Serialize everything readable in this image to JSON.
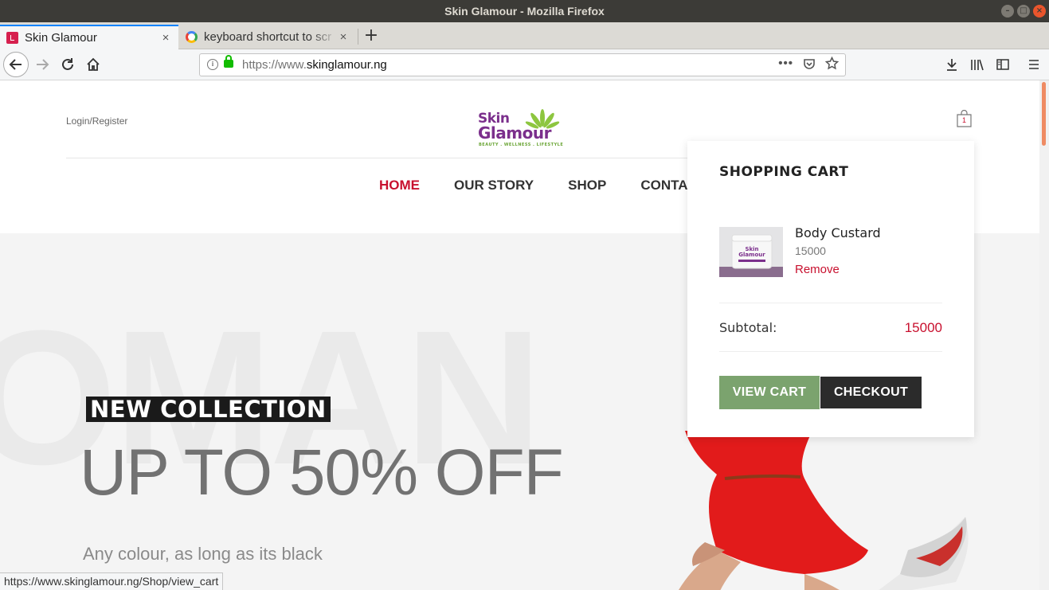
{
  "window": {
    "title": "Skin Glamour - Mozilla Firefox"
  },
  "tabs": [
    {
      "label": "Skin Glamour",
      "active": true
    },
    {
      "label": "keyboard shortcut to scr",
      "active": false
    }
  ],
  "url": {
    "scheme": "https://www.",
    "host": "skinglamour.ng"
  },
  "site": {
    "login_label": "Login/Register",
    "logo": {
      "line1": "Skin",
      "line2": "Glamour",
      "tagline": "BEAUTY . WELLNESS . LIFESTYLE"
    },
    "cart_count": "1",
    "nav": [
      {
        "label": "HOME",
        "active": true
      },
      {
        "label": "OUR STORY",
        "active": false
      },
      {
        "label": "SHOP",
        "active": false
      },
      {
        "label": "CONTACT",
        "active": false
      }
    ],
    "hero": {
      "bg_text": "OMAN",
      "badge": "NEW COLLECTION",
      "heading": "UP TO 50% OFF",
      "subtext": "Any colour, as long as its black"
    },
    "cart": {
      "title": "SHOPPING CART",
      "item": {
        "name": "Body Custard",
        "price": "15000",
        "remove": "Remove"
      },
      "subtotal_label": "Subtotal:",
      "subtotal_value": "15000",
      "view_cart": "VIEW CART",
      "checkout": "CHECKOUT"
    }
  },
  "statusbar": "https://www.skinglamour.ng/Shop/view_cart",
  "colors": {
    "accent": "#c8102e",
    "view_cart_btn": "#7ba36e",
    "checkout_btn": "#2b2b2b",
    "logo_purple": "#7b2f8c",
    "logo_green": "#6aa535"
  }
}
